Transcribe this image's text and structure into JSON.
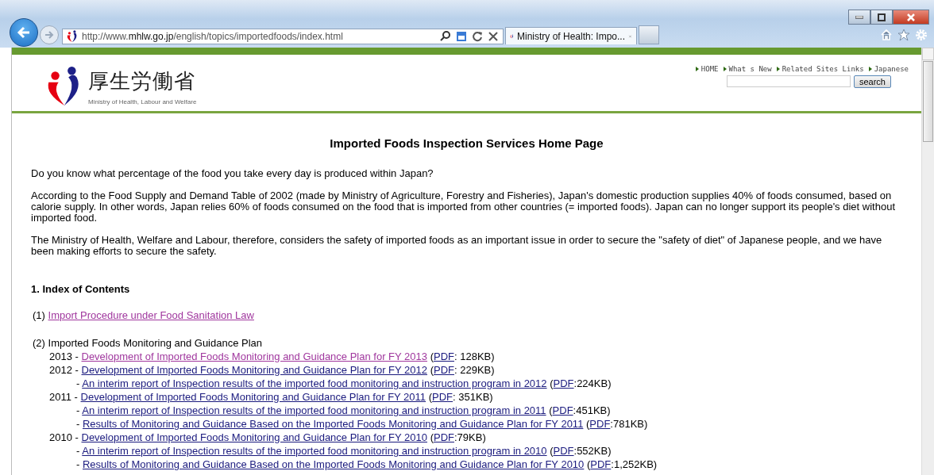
{
  "browser": {
    "address": "http://www.**mhlw.go.jp**/english/topics/importedfoods/index.html",
    "tab_title": "Ministry of Health: Impo..."
  },
  "site_header": {
    "logo_text": "厚生労働省",
    "logo_subtitle": "Ministry of Health, Labour and Welfare",
    "nav": [
      "HOME",
      "What s New",
      "Related Sites Links",
      "Japanese"
    ],
    "search_button": "search"
  },
  "heading": "Imported Foods Inspection Services Home Page",
  "paragraphs": [
    "Do you know what percentage of the food you take every day is produced within Japan?",
    "According to the Food Supply and Demand Table of 2002 (made by Ministry of Agriculture, Forestry and Fisheries), Japan's domestic production supplies 40% of foods consumed, based on calorie supply. In other words, Japan relies 60% of foods consumed on the food that is imported from other countries (= imported foods). Japan can no longer support its people's diet without imported food.",
    "The Ministry of Health, Welfare and Labour, therefore, considers the safety of imported foods as an important issue in order to secure the \"safety of diet\" of Japanese people, and we have been making efforts to secure the safety."
  ],
  "section_title": "1. Index of Contents",
  "items": [
    {
      "number": "(1)",
      "kind": "link",
      "text": "Import Procedure under Food Sanitation Law",
      "visited": true
    },
    {
      "number": "(2)",
      "kind": "plan",
      "text": "Imported Foods Monitoring and Guidance Plan",
      "entries": [
        {
          "lead": "2013 -",
          "title": "Development of Imported Foods Monitoring and Guidance Plan for FY 2013",
          "visited": true,
          "open": "(",
          "pdf": "PDF",
          "size": ": 128KB)"
        },
        {
          "lead": "2012 -",
          "title": "Development of Imported Foods Monitoring and Guidance Plan for FY 2012",
          "visited": false,
          "open": "(",
          "pdf": "PDF",
          "size": ": 229KB)",
          "children": [
            {
              "lead": "-",
              "title": "An interim report of Inspection results of the imported food monitoring and instruction program in 2012",
              "visited": false,
              "open": "(",
              "pdf": "PDF",
              "size": ":224KB)"
            }
          ]
        },
        {
          "lead": "2011 -",
          "title": "Development of Imported Foods Monitoring and Guidance Plan for FY 2011",
          "visited": false,
          "open": "(",
          "pdf": "PDF",
          "size": ": 351KB)",
          "children": [
            {
              "lead": "-",
              "title": "An interim report of Inspection results of the imported food monitoring and instruction program in 2011",
              "visited": false,
              "open": "(",
              "pdf": "PDF",
              "size": ":451KB)"
            },
            {
              "lead": "-",
              "title": "Results of Monitoring and Guidance Based on the Imported Foods Monitoring and Guidance Plan for FY 2011",
              "visited": false,
              "open": "(",
              "pdf": "PDF",
              "size": ":781KB)"
            }
          ]
        },
        {
          "lead": "2010 -",
          "title": "Development of Imported Foods Monitoring and Guidance Plan for FY 2010",
          "visited": false,
          "open": "(",
          "pdf": "PDF",
          "size": ":79KB)",
          "children": [
            {
              "lead": "-",
              "title": "An interim report of Inspection results of the imported food monitoring and instruction program in 2010",
              "visited": false,
              "open": "(",
              "pdf": "PDF",
              "size": ":552KB)"
            },
            {
              "lead": "-",
              "title": "Results of Monitoring and Guidance Based on the Imported Foods Monitoring and Guidance Plan for FY 2010",
              "visited": false,
              "open": "(",
              "pdf": "PDF",
              "size": ":1,252KB)"
            }
          ]
        }
      ]
    }
  ]
}
